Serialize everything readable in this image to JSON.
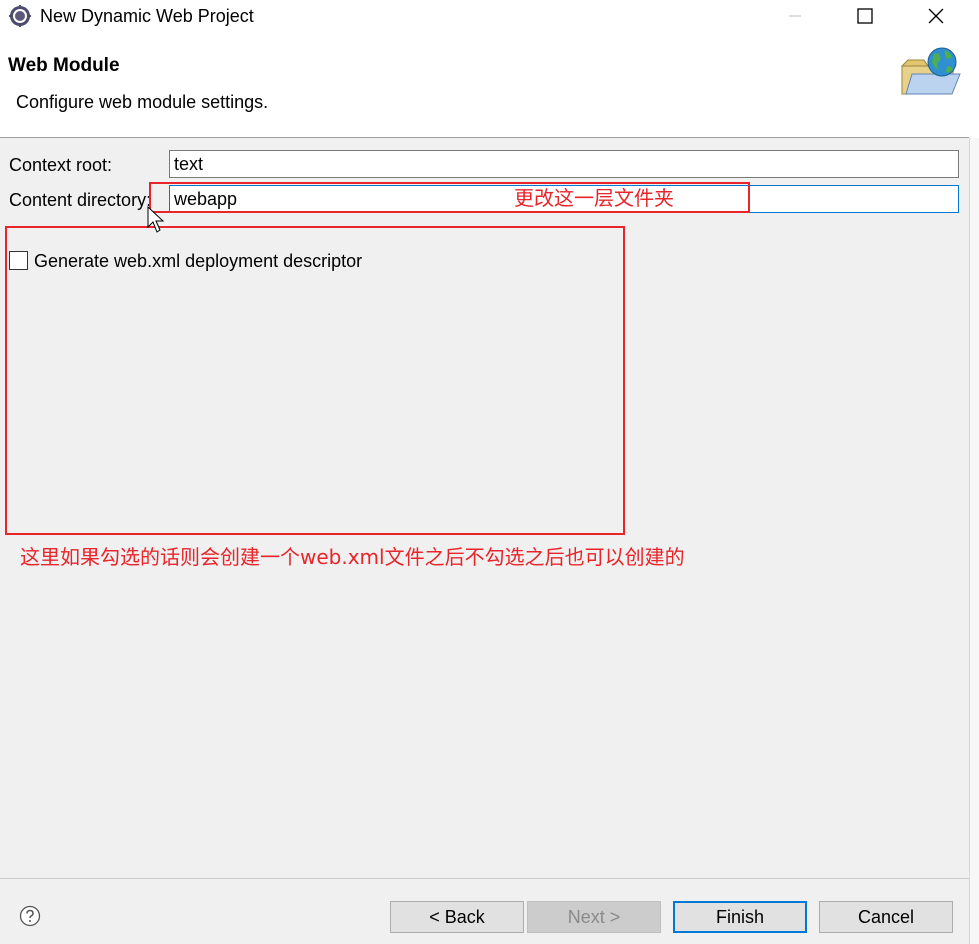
{
  "window": {
    "title": "New Dynamic Web Project",
    "icon": "eclipse-gear-icon",
    "controls": [
      "minimize-icon",
      "maximize-icon",
      "close-icon"
    ]
  },
  "header": {
    "title": "Web Module",
    "description": "Configure web module settings.",
    "icon": "web-folder-globe-icon"
  },
  "form": {
    "context_root": {
      "label": "Context root:",
      "value": "text"
    },
    "content_directory": {
      "label": "Content directory:",
      "value": "webapp"
    },
    "generate_descriptor": {
      "label": "Generate web.xml deployment descriptor",
      "checked": false
    }
  },
  "annotations": {
    "content_dir_note": "更改这一层文件夹",
    "checkbox_note": "这里如果勾选的话则会创建一个web.xml文件之后不勾选之后也可以创建的",
    "color": "#e8252b"
  },
  "buttons": {
    "back": "< Back",
    "next": "Next >",
    "finish": "Finish",
    "cancel": "Cancel",
    "help_icon": "help-question-icon"
  },
  "colors": {
    "dialog_bg": "#f0f0f0",
    "header_bg": "#ffffff",
    "focus_border": "#0078d7"
  }
}
